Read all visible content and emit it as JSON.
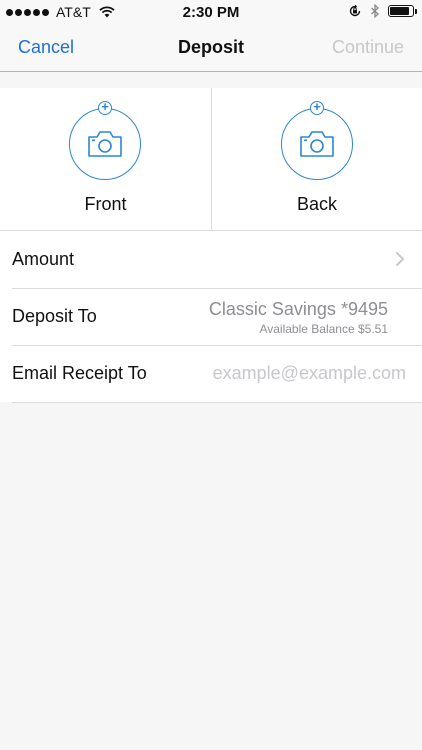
{
  "status_bar": {
    "carrier": "AT&T",
    "time": "2:30 PM",
    "battery_level": 0.85
  },
  "nav": {
    "cancel_label": "Cancel",
    "title": "Deposit",
    "continue_label": "Continue"
  },
  "capture": {
    "front_label": "Front",
    "back_label": "Back"
  },
  "form": {
    "amount_label": "Amount",
    "deposit_to_label": "Deposit To",
    "deposit_account": "Classic Savings *9495",
    "deposit_balance": "Available Balance $5.51",
    "email_label": "Email Receipt To",
    "email_placeholder": "example@example.com",
    "email_value": ""
  },
  "colors": {
    "accent": "#1f6fd6",
    "icon_blue": "#2e86d1",
    "disabled": "#c7c7cc",
    "secondary_text": "#8e8e93"
  }
}
